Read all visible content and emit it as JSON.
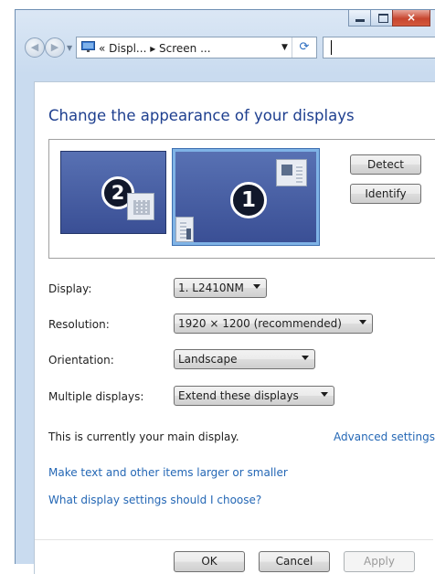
{
  "window": {
    "controls": {
      "minimize": "minimize",
      "maximize": "maximize",
      "close": "×"
    }
  },
  "navigation": {
    "back_icon": "back-arrow-icon",
    "forward_icon": "forward-arrow-icon",
    "address": {
      "breadcrumb": "« Displ... ▸ Screen ...",
      "refresh_glyph": "⟳"
    }
  },
  "main": {
    "title": "Change the appearance of your displays",
    "monitors": [
      {
        "number": "2"
      },
      {
        "number": "1"
      }
    ],
    "detect_label": "Detect",
    "identify_label": "Identify",
    "settings": {
      "display": {
        "label": "Display:",
        "value": "1. L2410NM"
      },
      "resolution": {
        "label": "Resolution:",
        "value": "1920 × 1200 (recommended)"
      },
      "orientation": {
        "label": "Orientation:",
        "value": "Landscape"
      },
      "multiple": {
        "label": "Multiple displays:",
        "value": "Extend these displays"
      }
    },
    "main_display_text": "This is currently your main display.",
    "advanced_link": "Advanced settings",
    "links": [
      "Make text and other items larger or smaller",
      "What display settings should I choose?"
    ]
  },
  "footer": {
    "ok": "OK",
    "cancel": "Cancel",
    "apply": "Apply"
  },
  "colors": {
    "title": "#1e3f8f",
    "link": "#2467b5",
    "monitor": "#4a60a6",
    "selected_border": "#7fb3e6"
  }
}
